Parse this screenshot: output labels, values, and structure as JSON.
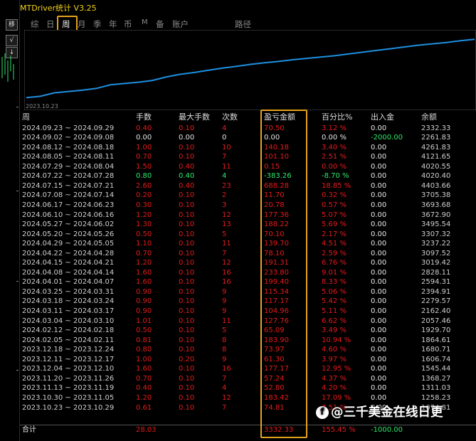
{
  "app": {
    "title": "MTDriver统计  V3.25"
  },
  "left_strip": {
    "btn1": "移",
    "btn2": "√",
    "btn3": "↓"
  },
  "tabs": [
    {
      "label": "综",
      "active": false
    },
    {
      "label": "日",
      "active": false
    },
    {
      "label": "周",
      "active": true
    },
    {
      "label": "月",
      "active": false
    },
    {
      "label": "季",
      "active": false
    },
    {
      "label": "年",
      "active": false
    },
    {
      "label": "币",
      "active": false
    },
    {
      "label": "M",
      "active": false
    },
    {
      "label": "备",
      "active": false
    },
    {
      "label": "账户",
      "active": false
    },
    {
      "label": "路径",
      "active": false
    }
  ],
  "chart_data": {
    "type": "line",
    "x_start_label": "2023.10.23",
    "values": [
      1011.8,
      1040,
      1120,
      1150,
      1180,
      1220,
      1300,
      1330,
      1360,
      1400,
      1480,
      1540,
      1580,
      1630,
      1680,
      1720,
      1765,
      1800,
      1830,
      1870,
      1900,
      1930,
      1960,
      2000,
      2040,
      2080,
      2120,
      2160,
      2200,
      2230,
      2262,
      2300,
      2332
    ],
    "ylim": [
      950,
      2450
    ],
    "colors": {
      "line": "#1e8fe0",
      "grid": "#2a2a2a"
    }
  },
  "table": {
    "headers": [
      "周",
      "手数",
      "最大手数",
      "次数",
      "盈亏金额",
      "百分比%",
      "出入金",
      "余额"
    ],
    "rows": [
      [
        "2024.09.23 ~ 2024.09.29",
        "0.40",
        "0.10",
        "4",
        "70.50",
        "3.12 %",
        "0.00",
        "2332.33",
        "r"
      ],
      [
        "2024.09.02 ~ 2024.09.08",
        "0.00",
        "0.00",
        "0",
        "0.00",
        "0.00 %",
        "-2000.00",
        "2261.83",
        "w"
      ],
      [
        "2024.08.12 ~ 2024.08.18",
        "1.00",
        "0.10",
        "10",
        "140.18",
        "3.40 %",
        "0.00",
        "4261.83",
        "r"
      ],
      [
        "2024.08.05 ~ 2024.08.11",
        "0.70",
        "0.10",
        "7",
        "101.10",
        "2.51 %",
        "0.00",
        "4121.65",
        "r"
      ],
      [
        "2024.07.29 ~ 2024.08.04",
        "1.50",
        "0.40",
        "11",
        "0.15",
        "0.00 %",
        "0.00",
        "4020.55",
        "r"
      ],
      [
        "2024.07.22 ~ 2024.07.28",
        "0.80",
        "0.40",
        "4",
        "-383.26",
        "-8.70 %",
        "0.00",
        "4020.40",
        "g"
      ],
      [
        "2024.07.15 ~ 2024.07.21",
        "2.60",
        "0.40",
        "23",
        "688.28",
        "18.85 %",
        "0.00",
        "4403.66",
        "r"
      ],
      [
        "2024.07.08 ~ 2024.07.14",
        "0.20",
        "0.10",
        "2",
        "11.70",
        "0.32 %",
        "0.00",
        "3705.38",
        "r"
      ],
      [
        "2024.06.17 ~ 2024.06.23",
        "0.30",
        "0.10",
        "3",
        "20.78",
        "0.57 %",
        "0.00",
        "3693.68",
        "r"
      ],
      [
        "2024.06.10 ~ 2024.06.16",
        "1.20",
        "0.10",
        "12",
        "177.36",
        "5.07 %",
        "0.00",
        "3672.90",
        "r"
      ],
      [
        "2024.05.27 ~ 2024.06.02",
        "1.30",
        "0.10",
        "13",
        "188.22",
        "5.69 %",
        "0.00",
        "3495.54",
        "r"
      ],
      [
        "2024.05.20 ~ 2024.05.26",
        "0.50",
        "0.10",
        "5",
        "70.10",
        "2.17 %",
        "0.00",
        "3307.32",
        "r"
      ],
      [
        "2024.04.29 ~ 2024.05.05",
        "1.10",
        "0.10",
        "11",
        "139.70",
        "4.51 %",
        "0.00",
        "3237.22",
        "r"
      ],
      [
        "2024.04.22 ~ 2024.04.28",
        "0.70",
        "0.10",
        "7",
        "78.10",
        "2.59 %",
        "0.00",
        "3097.52",
        "r"
      ],
      [
        "2024.04.15 ~ 2024.04.21",
        "1.20",
        "0.10",
        "12",
        "191.31",
        "6.76 %",
        "0.00",
        "3019.42",
        "r"
      ],
      [
        "2024.04.08 ~ 2024.04.14",
        "1.60",
        "0.10",
        "16",
        "233.80",
        "9.01 %",
        "0.00",
        "2828.11",
        "r"
      ],
      [
        "2024.04.01 ~ 2024.04.07",
        "1.60",
        "0.10",
        "16",
        "199.40",
        "8.33 %",
        "0.00",
        "2594.31",
        "r"
      ],
      [
        "2024.03.25 ~ 2024.03.31",
        "0.90",
        "0.10",
        "9",
        "115.34",
        "5.06 %",
        "0.00",
        "2394.91",
        "r"
      ],
      [
        "2024.03.18 ~ 2024.03.24",
        "0.90",
        "0.10",
        "9",
        "117.17",
        "5.42 %",
        "0.00",
        "2279.57",
        "r"
      ],
      [
        "2024.03.11 ~ 2024.03.17",
        "0.90",
        "0.10",
        "9",
        "104.96",
        "5.11 %",
        "0.00",
        "2162.40",
        "r"
      ],
      [
        "2024.03.04 ~ 2024.03.10",
        "1.01",
        "0.10",
        "11",
        "127.76",
        "6.62 %",
        "0.00",
        "2057.46",
        "r"
      ],
      [
        "2024.02.12 ~ 2024.02.18",
        "0.50",
        "0.10",
        "5",
        "65.09",
        "3.49 %",
        "0.00",
        "1929.70",
        "r"
      ],
      [
        "2024.02.05 ~ 2024.02.11",
        "0.81",
        "0.10",
        "8",
        "183.90",
        "10.94 %",
        "0.00",
        "1864.61",
        "r"
      ],
      [
        "2023.12.18 ~ 2023.12.24",
        "0.80",
        "0.10",
        "8",
        "73.97",
        "4.60 %",
        "0.00",
        "1680.71",
        "r"
      ],
      [
        "2023.12.11 ~ 2023.12.17",
        "1.00",
        "0.20",
        "9",
        "61.30",
        "3.97 %",
        "0.00",
        "1606.74",
        "r"
      ],
      [
        "2023.12.04 ~ 2023.12.10",
        "1.60",
        "0.10",
        "16",
        "177.17",
        "12.95 %",
        "0.00",
        "1545.44",
        "r"
      ],
      [
        "2023.11.20 ~ 2023.11.26",
        "0.70",
        "0.10",
        "7",
        "57.24",
        "4.37 %",
        "0.00",
        "1368.27",
        "r"
      ],
      [
        "2023.11.13 ~ 2023.11.19",
        "0.40",
        "0.10",
        "4",
        "52.80",
        "4.20 %",
        "0.00",
        "1311.03",
        "r"
      ],
      [
        "2023.10.30 ~ 2023.11.05",
        "1.20",
        "0.10",
        "12",
        "183.42",
        "17.09 %",
        "0.00",
        "1258.23",
        "r"
      ],
      [
        "2023.10.23 ~ 2023.10.29",
        "0.61",
        "0.10",
        "7",
        "74.81",
        "7.51 %",
        "0.00",
        "1074.81",
        "r"
      ]
    ],
    "total": {
      "label": "合计",
      "lots": "28.03",
      "pl": "3332.33",
      "pct": "155.45 %",
      "inout": "-1000.00"
    }
  },
  "watermark": {
    "logo": "f",
    "text": "@三千美金在线日更"
  }
}
